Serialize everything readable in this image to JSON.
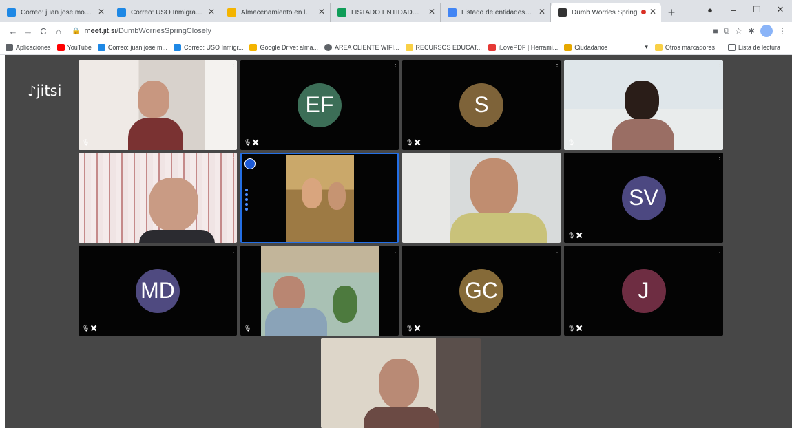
{
  "browser": {
    "tabs": [
      {
        "title": "Correo: juan jose moreno",
        "fav": "#1e88e5"
      },
      {
        "title": "Correo: USO Inmigracion",
        "fav": "#1e88e5"
      },
      {
        "title": "Almacenamiento en la nube",
        "fav": "#f4b400"
      },
      {
        "title": "LISTADO ENTIDADES PEHI",
        "fav": "#0f9d58"
      },
      {
        "title": "Listado de entidades PEHI",
        "fav": "#4285f4"
      },
      {
        "title": "Dumb Worries Spring",
        "fav": "#333333"
      }
    ],
    "new_tab": "+",
    "address": {
      "host": "meet.jit.si",
      "path": "/DumbWorriesSpringClosely"
    },
    "nav": {
      "back": "←",
      "forward": "→",
      "reload": "C",
      "home": "⌂"
    }
  },
  "bookmarks": {
    "items": [
      {
        "label": "Aplicaciones",
        "color": "#5f6368"
      },
      {
        "label": "YouTube",
        "color": "#ff0000"
      },
      {
        "label": "Correo: juan jose m...",
        "color": "#1e88e5"
      },
      {
        "label": "Correo: USO Inmigr...",
        "color": "#1e88e5"
      },
      {
        "label": "Google Drive: alma...",
        "color": "#f4b400"
      },
      {
        "label": "AREA CLIENTE WIFI...",
        "color": "#5f6368"
      },
      {
        "label": "RECURSOS EDUCAT...",
        "color": "#f9d046"
      },
      {
        "label": "iLovePDF | Herrami...",
        "color": "#e53935"
      },
      {
        "label": "Ciudadanos",
        "color": "#e6a800"
      }
    ],
    "other": "Otros marcadores",
    "reading_list": "Lista de lectura"
  },
  "meeting": {
    "logo": "jitsi",
    "participants": [
      {
        "initials": "EF",
        "color": "#3c6e57"
      },
      {
        "initials": "S",
        "color": "#7e6339"
      },
      {
        "initials": "SV",
        "color": "#4c4881"
      },
      {
        "initials": "MD",
        "color": "#4f4a80"
      },
      {
        "initials": "GC",
        "color": "#856a38"
      },
      {
        "initials": "J",
        "color": "#6e2d42"
      }
    ]
  }
}
